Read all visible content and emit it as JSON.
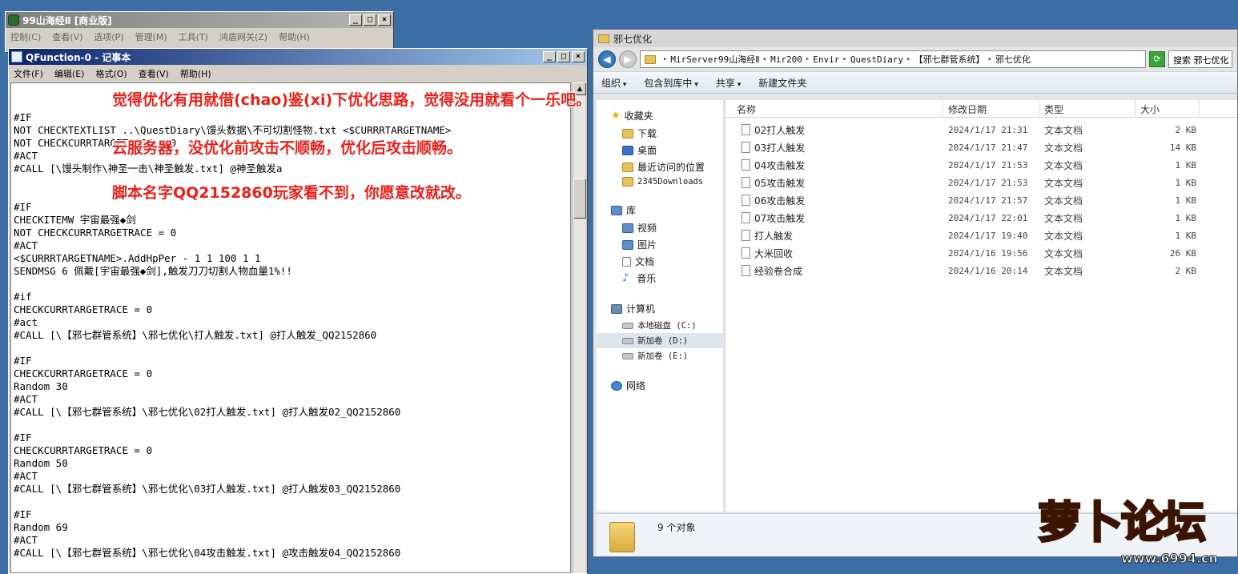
{
  "back_window": {
    "title": "99山海经Ⅱ [商业版]",
    "menu": [
      "控制(C)",
      "查看(V)",
      "选项(P)",
      "管理(M)",
      "工具(T)",
      "鸿盾网关(Z)",
      "帮助(H)"
    ]
  },
  "notepad": {
    "title": "QFunction-0 - 记事本",
    "menu": [
      "文件(F)",
      "编辑(E)",
      "格式(O)",
      "查看(V)",
      "帮助(H)"
    ],
    "content": "\n#IF\nNOT CHECKTEXTLIST ..\\QuestDiary\\馒头数据\\不可切割怪物.txt <$CURRRTARGETNAME>\nNOT CHECKCURRTARGETRACE = 0\n#ACT\n#CALL [\\馒头制作\\神圣一击\\神圣触发.txt] @神圣触发a\n\n\n#IF\nCHECKITEMW 宇宙最强◆剑\nNOT CHECKCURRTARGETRACE = 0\n#ACT\n<$CURRRTARGETNAME>.AddHpPer - 1 1 100 1 1\nSENDMSG 6 佩戴[宇宙最强◆剑],触发刀刀切割人物血量1%!!\n\n#if\nCHECKCURRTARGETRACE = 0\n#act\n#CALL [\\【邪七群管系统】\\邪七优化\\打人触发.txt] @打人触发_QQ2152860\n\n#IF\nCHECKCURRTARGETRACE = 0\nRandom 30\n#ACT\n#CALL [\\【邪七群管系统】\\邪七优化\\02打人触发.txt] @打人触发02_QQ2152860\n\n#IF\nCHECKCURRTARGETRACE = 0\nRandom 50\n#ACT\n#CALL [\\【邪七群管系统】\\邪七优化\\03打人触发.txt] @打人触发03_QQ2152860\n\n#IF\nRandom 69\n#ACT\n#CALL [\\【邪七群管系统】\\邪七优化\\04攻击触发.txt] @攻击触发04_QQ2152860"
  },
  "annotations": {
    "line1": "觉得优化有用就借(chao)鉴(xi)下优化思路，觉得没用就看个一乐吧。",
    "line2": "云服务器，没优化前攻击不顺畅，优化后攻击顺畅。",
    "line3": "脚本名字QQ2152860玩家看不到，你愿意改就改。"
  },
  "explorer": {
    "title": "邪七优化",
    "breadcrumb": [
      "MirServer99山海经Ⅱ",
      "Mir200",
      "Envir",
      "QuestDiary",
      "【邪七群管系统】",
      "邪七优化"
    ],
    "search_placeholder": "搜索 邪七优化",
    "toolbar": [
      "组织",
      "包含到库中",
      "共享",
      "新建文件夹"
    ],
    "nav": {
      "favorites": "收藏夹",
      "fav_items": [
        "下载",
        "桌面",
        "最近访问的位置",
        "2345Downloads"
      ],
      "libraries": "库",
      "lib_items": [
        "视频",
        "图片",
        "文档",
        "音乐"
      ],
      "computer": "计算机",
      "comp_items": [
        "本地磁盘 (C:)",
        "新加卷 (D:)",
        "新加卷 (E:)"
      ],
      "network": "网络"
    },
    "columns": [
      "名称",
      "修改日期",
      "类型",
      "大小"
    ],
    "files": [
      {
        "name": "02打人触发",
        "date": "2024/1/17 21:31",
        "type": "文本文档",
        "size": "2 KB"
      },
      {
        "name": "03打人触发",
        "date": "2024/1/17 21:47",
        "type": "文本文档",
        "size": "14 KB"
      },
      {
        "name": "04攻击触发",
        "date": "2024/1/17 21:53",
        "type": "文本文档",
        "size": "1 KB"
      },
      {
        "name": "05攻击触发",
        "date": "2024/1/17 21:53",
        "type": "文本文档",
        "size": "1 KB"
      },
      {
        "name": "06攻击触发",
        "date": "2024/1/17 21:57",
        "type": "文本文档",
        "size": "1 KB"
      },
      {
        "name": "07攻击触发",
        "date": "2024/1/17 22:01",
        "type": "文本文档",
        "size": "1 KB"
      },
      {
        "name": "打人触发",
        "date": "2024/1/17 19:40",
        "type": "文本文档",
        "size": "1 KB"
      },
      {
        "name": "大米回收",
        "date": "2024/1/16 19:56",
        "type": "文本文档",
        "size": "26 KB"
      },
      {
        "name": "经验卷合成",
        "date": "2024/1/16 20:14",
        "type": "文本文档",
        "size": "2 KB"
      }
    ],
    "status": "9 个对象"
  },
  "logo": {
    "text": "萝卜论坛",
    "url": "www.6994.cn"
  }
}
